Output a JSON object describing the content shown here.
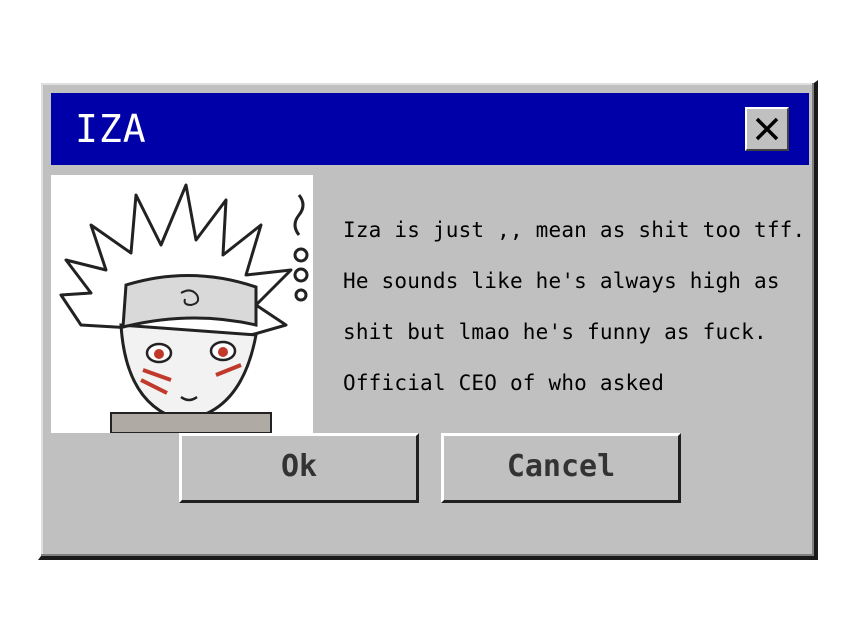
{
  "window": {
    "title": "IZA",
    "close_icon": "close-icon"
  },
  "message": {
    "text": "Iza is just ,, mean as shit too tff. He sounds like he's always high as shit but lmao he's funny as fuck. Official CEO of who asked"
  },
  "buttons": {
    "ok_label": "Ok",
    "cancel_label": "Cancel"
  },
  "image": {
    "description_icon": "anime-character-avatar"
  },
  "colors": {
    "titlebar": "#0000a8",
    "dialog_bg": "#c0c0c0",
    "title_text": "#ffffff"
  }
}
